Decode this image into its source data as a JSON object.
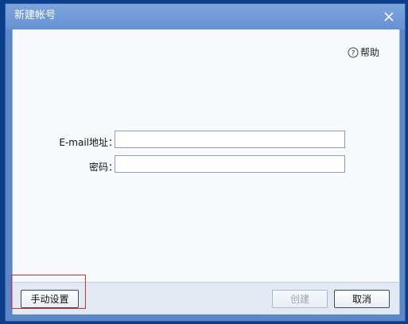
{
  "dialog": {
    "title": "新建帐号",
    "close_icon": "close-icon"
  },
  "help": {
    "icon": "question-circle-icon",
    "label": "帮助"
  },
  "form": {
    "email_label": "E-mail地址：",
    "email_value": "",
    "password_label": "密码：",
    "password_value": ""
  },
  "footer": {
    "manual_setup_label": "手动设置",
    "create_label": "创建",
    "create_disabled": true,
    "cancel_label": "取消"
  },
  "colors": {
    "titlebar": "#6f98d8",
    "content_bg": "#f8f9fc",
    "footer_bg": "#e3e9f3",
    "highlight": "#d83030"
  }
}
